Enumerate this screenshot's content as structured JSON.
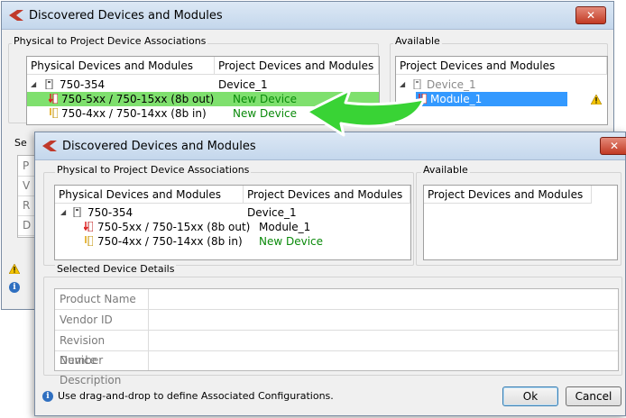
{
  "back_window": {
    "title": "Discovered Devices and Modules",
    "close_label": "✕",
    "group_associations": "Physical to Project Device Associations",
    "group_available": "Available",
    "col_physical": "Physical Devices and Modules",
    "col_project": "Project Devices and Modules",
    "rows": [
      {
        "name": "750-354",
        "project": "Device_1"
      },
      {
        "name": "750-5xx / 750-15xx (8b out)",
        "project": "New Device"
      },
      {
        "name": "750-4xx / 750-14xx (8b in)",
        "project": "New Device"
      }
    ],
    "available_header": "Project Devices and Modules",
    "available_rows": [
      {
        "name": "Device_1"
      },
      {
        "name": "Module_1"
      }
    ],
    "selected_label_fragment": "Se",
    "left_field_initials": [
      "P",
      "V",
      "R",
      "D"
    ]
  },
  "front_window": {
    "title": "Discovered Devices and Modules",
    "close_label": "✕",
    "group_associations": "Physical to Project Device Associations",
    "group_available": "Available",
    "col_physical": "Physical Devices and Modules",
    "col_project": "Project Devices and Modules",
    "rows": [
      {
        "name": "750-354",
        "project": "Device_1"
      },
      {
        "name": "750-5xx / 750-15xx (8b out)",
        "project": "Module_1"
      },
      {
        "name": "750-4xx / 750-14xx (8b in)",
        "project": "New Device"
      }
    ],
    "available_header": "Project Devices and Modules",
    "selected_details_label": "Selected Device Details",
    "details": [
      {
        "label": "Product Name",
        "value": ""
      },
      {
        "label": "Vendor ID",
        "value": ""
      },
      {
        "label": "Revision Number",
        "value": ""
      },
      {
        "label": "Device Description",
        "value": ""
      }
    ],
    "hint": "Use drag-and-drop to define Associated Configurations.",
    "ok_label": "Ok",
    "cancel_label": "Cancel"
  },
  "colors": {
    "highlight_green": "#7fe06e",
    "selection_blue": "#3399ff",
    "arrow_green": "#39d335",
    "new_device_green": "#0a8a0a"
  },
  "icons": [
    "app-logo-icon",
    "close-icon",
    "device-icon",
    "output-module-icon",
    "input-module-icon",
    "warning-icon",
    "info-icon",
    "drag-arrow-icon",
    "expand-arrow-icon"
  ]
}
